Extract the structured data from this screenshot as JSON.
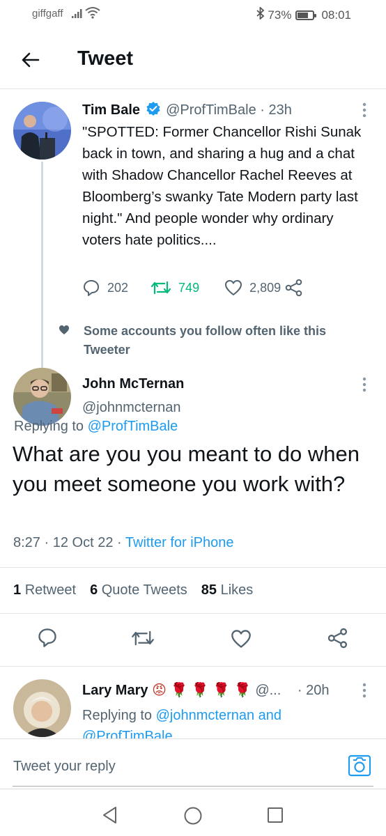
{
  "status_bar": {
    "carrier": "giffgaff",
    "battery_text": "73%",
    "battery_level": 0.73,
    "time": "08:01"
  },
  "header": {
    "title": "Tweet"
  },
  "tweet1": {
    "name": "Tim Bale",
    "handle": "@ProfTimBale",
    "sep": "·",
    "time": "23h",
    "text": "\"SPOTTED: Former Chancellor Rishi Sunak back in town, and sharing a hug and a chat with Shadow Chancellor Rachel Reeves at Bloomberg’s swanky Tate Modern party last night.\" And people wonder why ordinary voters hate politics....",
    "replies": "202",
    "retweets": "749",
    "likes": "2,809"
  },
  "social_context": {
    "text": "Some accounts you follow often like this Tweeter"
  },
  "tweet2": {
    "name": "John McTernan",
    "handle": "@johnmcternan",
    "replying_prefix": "Replying to",
    "replying_handle": "@ProfTimBale",
    "text": "What are you you meant to do when you meet someone you work with?",
    "time": "8:27",
    "date": "12 Oct 22",
    "sep": "·",
    "source": "Twitter for iPhone",
    "retweet_count": "1",
    "retweet_label": "Retweet",
    "quote_count": "6",
    "quote_label": "Quote Tweets",
    "like_count": "85",
    "like_label": "Likes"
  },
  "tweet3": {
    "name": "Lary Mary",
    "emoji": "😡 🌹 🌹 🌹 🌹",
    "handle": "@...",
    "sep": "·",
    "time": "20h",
    "replying_prefix": "Replying to",
    "replying_handle1": "@johnmcternan",
    "replying_and": "and",
    "replying_handle2": "@ProfTimBale"
  },
  "reply_bar": {
    "placeholder": "Tweet your reply"
  },
  "icons": {
    "back": "arrow-left-icon",
    "more": "more-vertical-icon",
    "reply": "reply-icon",
    "retweet": "retweet-icon",
    "like": "heart-icon",
    "share": "share-icon",
    "camera": "camera-icon",
    "verified": "verified-badge-icon"
  },
  "colors": {
    "accent": "#1d9bf0",
    "retweet_green": "#00ba7c",
    "muted": "#536471"
  }
}
